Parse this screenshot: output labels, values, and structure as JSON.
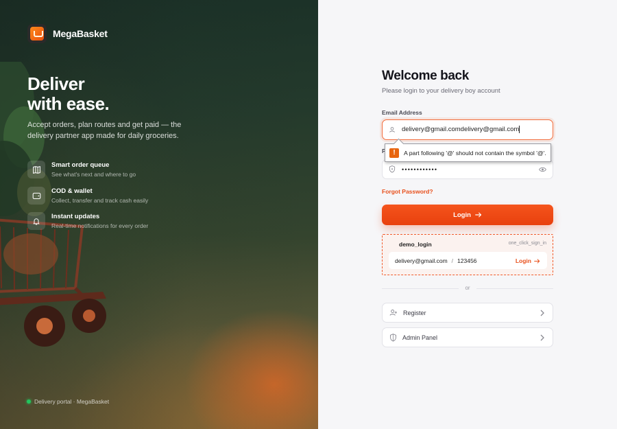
{
  "brand": {
    "name": "MegaBasket"
  },
  "hero": {
    "headline_line1": "Deliver",
    "headline_line2": "with ease.",
    "lead": "Accept orders, plan routes and get paid — the delivery partner app made for daily groceries.",
    "features": [
      {
        "title": "Smart order queue",
        "subtitle": "See what's next and where to go",
        "icon": "map-icon"
      },
      {
        "title": "COD & wallet",
        "subtitle": "Collect, transfer and track cash easily",
        "icon": "wallet-icon"
      },
      {
        "title": "Instant updates",
        "subtitle": "Real-time notifications for every order",
        "icon": "bell-icon"
      }
    ],
    "footer_status": "Delivery portal · MegaBasket"
  },
  "login": {
    "title": "Welcome back",
    "subtitle": "Please login to your delivery boy account",
    "email_label": "Email Address",
    "email_value": "delivery@gmail.comdelivery@gmail.com",
    "password_label_initial": "P",
    "password_value": "••••••••••••",
    "validation_message": "A part following '@' should not contain the symbol '@'.",
    "forgot_label": "Forgot Password?",
    "login_button": "Login"
  },
  "demo": {
    "title": "demo_login",
    "tag": "one_click_sign_in",
    "email": "delivery@gmail.com",
    "separator": "/",
    "password": "123456",
    "login_label": "Login"
  },
  "divider_text": "or",
  "links": {
    "register": "Register",
    "admin": "Admin Panel"
  },
  "colors": {
    "accent": "#e8400e",
    "status_online": "#22c55e"
  }
}
